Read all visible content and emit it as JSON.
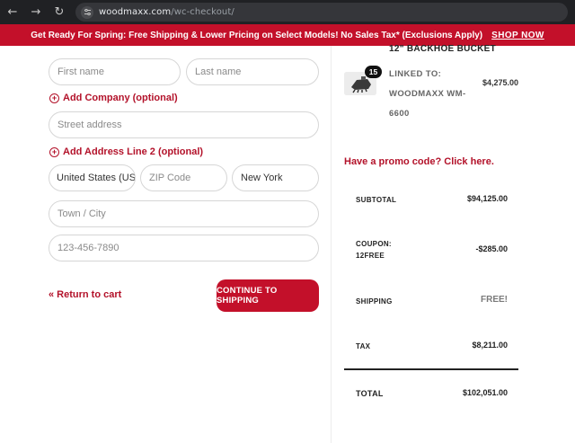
{
  "browser": {
    "url_host": "woodmaxx.com",
    "url_path": "/wc-checkout/"
  },
  "banner": {
    "message": "Get Ready For Spring: Free Shipping & Lower Pricing on Select Models! No Sales Tax* (Exclusions Apply)",
    "cta": "SHOP NOW"
  },
  "form": {
    "first_name_placeholder": "First name",
    "last_name_placeholder": "Last name",
    "add_company": "Add Company (optional)",
    "street_placeholder": "Street address",
    "add_address_line2": "Add Address Line 2 (optional)",
    "country_value": "United States (US)",
    "zip_placeholder": "ZIP Code",
    "state_value": "New York",
    "town_placeholder": "Town / City",
    "phone_placeholder": "123-456-7890",
    "return_to_cart": "« Return to cart",
    "continue_button": "CONTINUE TO SHIPPING"
  },
  "order": {
    "product_name": "12\" BACKHOE BUCKET",
    "quantity": "15",
    "linked_to": [
      "LINKED TO:",
      "WOODMAXX WM-",
      "6600"
    ],
    "line_price": "$4,275.00",
    "promo_link": "Have a promo code? Click here.",
    "summary": {
      "subtotal_label": "SUBTOTAL",
      "subtotal_value": "$94,125.00",
      "coupon_label": "COUPON:",
      "coupon_code": "12FREE",
      "coupon_value": "-$285.00",
      "shipping_label": "SHIPPING",
      "shipping_value": "FREE!",
      "tax_label": "TAX",
      "tax_value": "$8,211.00",
      "total_label": "TOTAL",
      "total_value": "$102,051.00"
    }
  },
  "colors": {
    "brand_red": "#c3102a",
    "link_red": "#b3122a"
  }
}
